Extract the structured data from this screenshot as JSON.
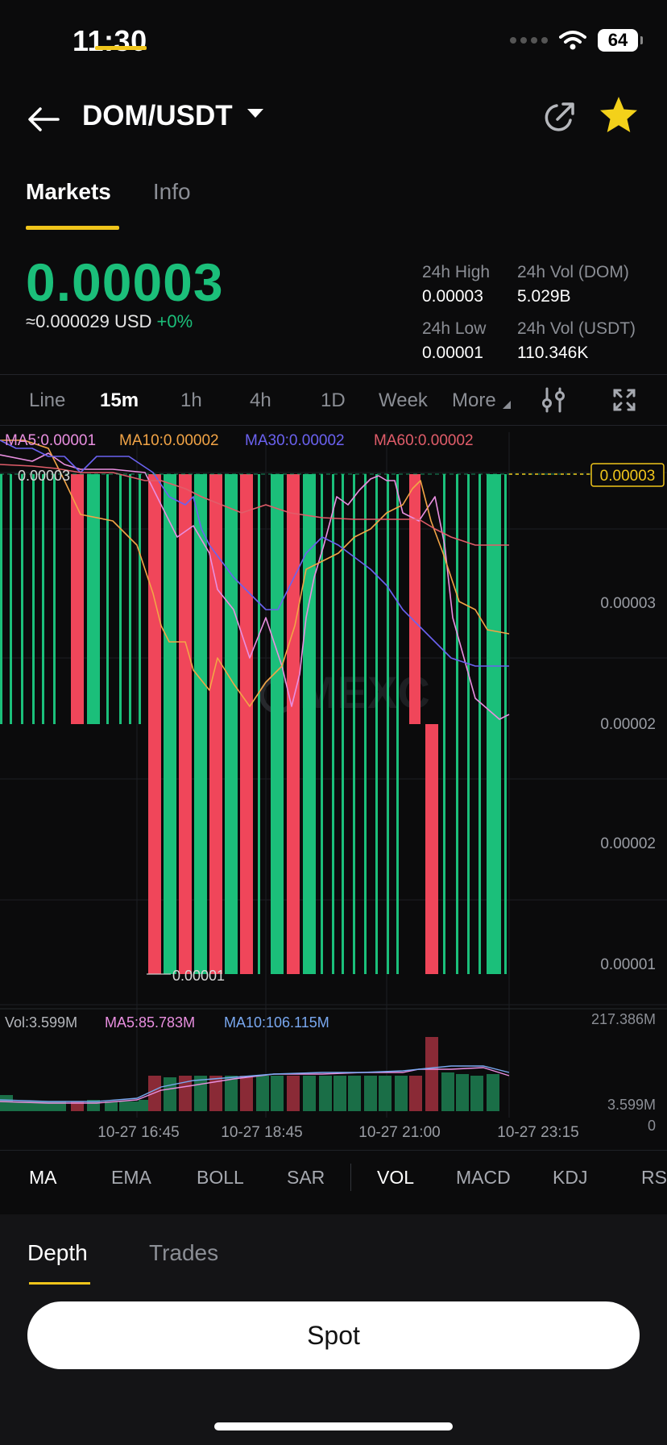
{
  "status_bar": {
    "time": "11:30",
    "battery": "64"
  },
  "header": {
    "pair": "DOM/USDT"
  },
  "tabs": {
    "markets": "Markets",
    "info": "Info"
  },
  "ticker": {
    "last_price": "0.00003",
    "fiat_price": "≈0.000029",
    "fiat_unit": "USD",
    "change": "+0%",
    "high_label": "24h High",
    "high_value": "0.00003",
    "low_label": "24h Low",
    "low_value": "0.00001",
    "vol_base_label": "24h Vol (DOM)",
    "vol_base_value": "5.029B",
    "vol_quote_label": "24h Vol  (USDT)",
    "vol_quote_value": "110.346K"
  },
  "timeframes": [
    "Line",
    "15m",
    "1h",
    "4h",
    "1D",
    "Week",
    "More"
  ],
  "active_timeframe": "15m",
  "ma_legend": {
    "ma5": "MA5:0.00001",
    "ma10": "MA10:0.00002",
    "ma30": "MA30:0.00002",
    "ma60": "MA60:0.00002"
  },
  "colors": {
    "up": "#1bbf7a",
    "down": "#f0465a",
    "ma5": "#e98fe0",
    "ma10": "#f2a446",
    "ma30": "#6b62f0",
    "ma60": "#e15d6a",
    "accent": "#f0c51b"
  },
  "chart_data": {
    "type": "candlestick",
    "y_axis_ticks": [
      "0.00003",
      "0.00002",
      "0.00002",
      "0.00001"
    ],
    "price_tag": "0.00003",
    "high_marker": "0.00003",
    "low_marker": "0.00001",
    "x_ticks": [
      "10-27 16:45",
      "10-27 18:45",
      "10-27 21:00",
      "10-27 23:15"
    ],
    "volume": {
      "current": "Vol:3.599M",
      "ma5": "MA5:85.783M",
      "ma10": "MA10:106.115M",
      "axis_max": "217.386M",
      "axis_mid": "3.599M",
      "axis_zero": "0"
    }
  },
  "indicators": [
    "MA",
    "EMA",
    "BOLL",
    "SAR",
    "VOL",
    "MACD",
    "KDJ",
    "RS"
  ],
  "bottom_tabs": {
    "depth": "Depth",
    "trades": "Trades"
  },
  "spot_button": "Spot"
}
